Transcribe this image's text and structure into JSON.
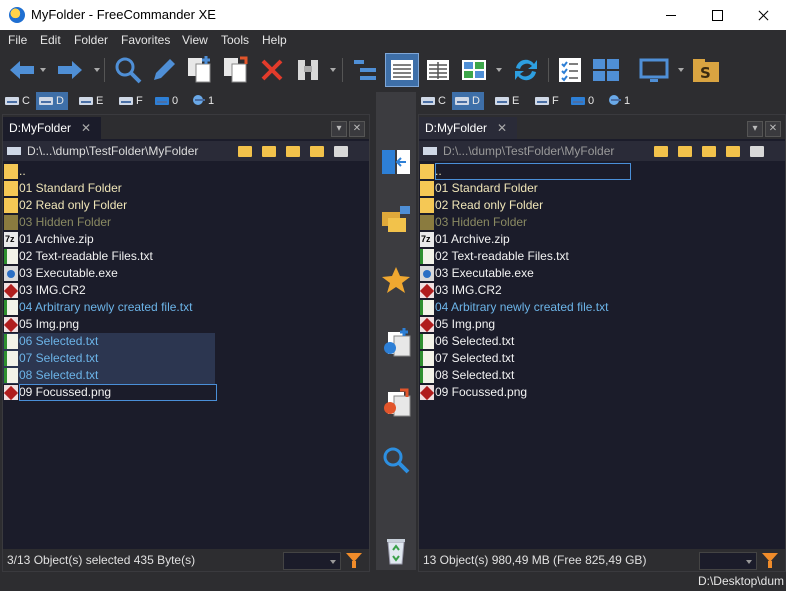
{
  "window": {
    "title": "MyFolder - FreeCommander XE"
  },
  "menu": [
    "File",
    "Edit",
    "Folder",
    "Favorites",
    "View",
    "Tools",
    "Help"
  ],
  "drives": [
    {
      "label": "C",
      "icon": "hdd-icon"
    },
    {
      "label": "D",
      "icon": "hdd-icon",
      "selected": true
    },
    {
      "label": "E",
      "icon": "hdd-icon"
    },
    {
      "label": "F",
      "icon": "hdd-icon"
    },
    {
      "label": "0",
      "icon": "monitor-icon"
    },
    {
      "label": "1",
      "icon": "network-icon"
    }
  ],
  "left": {
    "tab": "D:MyFolder",
    "path": "D:\\...\\dump\\TestFolder\\MyFolder",
    "status": "3/13 Object(s) selected   435 Byte(s)"
  },
  "right": {
    "tab": "D:MyFolder",
    "path": "D:\\...\\dump\\TestFolder\\MyFolder",
    "status": "13 Object(s)   980,49 MB   (Free 825,49 GB)"
  },
  "files": [
    {
      "name": "..",
      "type": "parent"
    },
    {
      "name": "01 Standard Folder",
      "type": "folder"
    },
    {
      "name": "02 Read only Folder",
      "type": "folder"
    },
    {
      "name": "03 Hidden Folder",
      "type": "hidden"
    },
    {
      "name": "01 Archive.zip",
      "type": "file",
      "icon": "zip"
    },
    {
      "name": "02 Text-readable Files.txt",
      "type": "file",
      "icon": "txt"
    },
    {
      "name": "03 Executable.exe",
      "type": "file",
      "icon": "exe"
    },
    {
      "name": "03 IMG.CR2",
      "type": "file",
      "icon": "img"
    },
    {
      "name": "04 Arbitrary newly created file.txt",
      "type": "new",
      "icon": "txt"
    },
    {
      "name": "05 Img.png",
      "type": "file",
      "icon": "img"
    },
    {
      "name": "06 Selected.txt",
      "type": "sel",
      "icon": "txt"
    },
    {
      "name": "07 Selected.txt",
      "type": "sel",
      "icon": "txt"
    },
    {
      "name": "08 Selected.txt",
      "type": "sel",
      "icon": "txt"
    },
    {
      "name": "09 Focussed.png",
      "type": "file",
      "icon": "img"
    }
  ],
  "bottom": {
    "path": "D:\\Desktop\\dum"
  },
  "colors": {
    "accent": "#3e6fa8",
    "folder": "#f5c855",
    "link_blue": "#6cb4e8",
    "panel_bg": "#1b1c2a"
  }
}
